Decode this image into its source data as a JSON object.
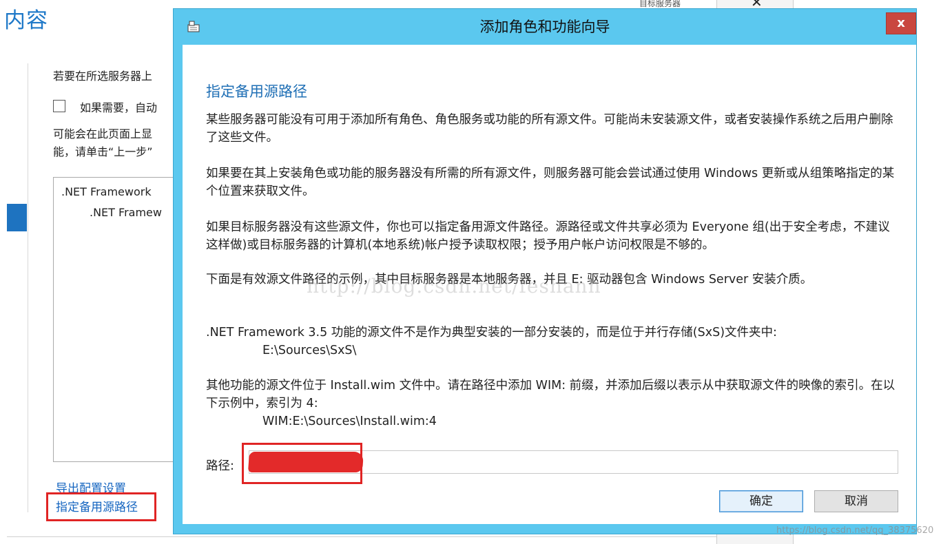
{
  "background": {
    "page_title": "内容",
    "intro_text": "若要在所选服务器上",
    "checkbox_label": "如果需要，自动",
    "note_line1": "可能会在此页面上显",
    "note_line2": "能，请单击“上一步”",
    "list_items": [
      ".NET Framework",
      ".NET Framew"
    ],
    "link_export": "导出配置设置",
    "link_specify_source": "指定备用源路径",
    "top_right_text": "目标服务器"
  },
  "dialog": {
    "title": "添加角色和功能向导",
    "close_label": "x",
    "heading": "指定备用源路径",
    "para1": "某些服务器可能没有可用于添加所有角色、角色服务或功能的所有源文件。可能尚未安装源文件，或者安装操作系统之后用户删除了这些文件。",
    "para2": "如果要在其上安装角色或功能的服务器没有所需的所有源文件，则服务器可能会尝试通过使用 Windows 更新或从组策略指定的某个位置来获取文件。",
    "para3": "如果目标服务器没有这些源文件，你也可以指定备用源文件路径。源路径或文件共享必须为 Everyone 组(出于安全考虑，不建议这样做)或目标服务器的计算机(本地系统)帐户授予读取权限；授予用户帐户访问权限是不够的。",
    "para4": "下面是有效源文件路径的示例，其中目标服务器是本地服务器，并且 E: 驱动器包含 Windows Server 安装介质。",
    "para5": ".NET Framework 3.5 功能的源文件不是作为典型安装的一部分安装的，而是位于并行存储(SxS)文件夹中:",
    "para5_path": "E:\\Sources\\SxS\\",
    "para6": "其他功能的源文件位于 Install.wim 文件中。请在路径中添加 WIM: 前缀，并添加后缀以表示从中获取源文件的映像的索引。在以下示例中，索引为 4:",
    "para6_path": "WIM:E:\\Sources\\Install.wim:4",
    "path_label": "路径:",
    "path_value": "",
    "ok_label": "确定",
    "cancel_label": "取消",
    "watermark": "http://blog.csdn.net/feshanh"
  },
  "footer_watermark": "https://blog.csdn.net/qq_38375620",
  "colors": {
    "dialog_frame": "#5bc8ef",
    "heading": "#1f6fb5",
    "close_button": "#c9473f",
    "highlight_box": "#e02424",
    "link": "#1565c0"
  }
}
